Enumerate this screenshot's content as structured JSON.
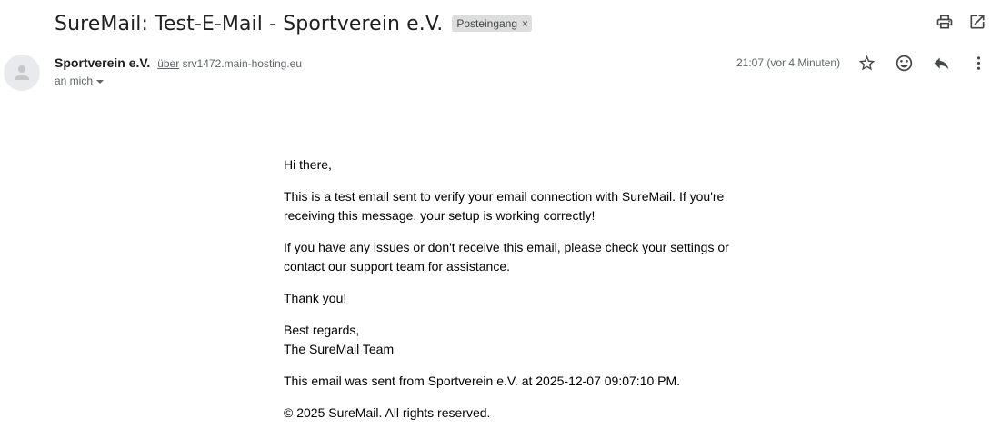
{
  "email": {
    "subject": "SureMail: Test-E-Mail - Sportverein e.V.",
    "label": "Posteingang",
    "label_remove": "×",
    "sender_name": "Sportverein e.V.",
    "via_word": "über",
    "via_domain": "srv1472.main-hosting.eu",
    "recipient": "an mich",
    "time": "21:07 (vor 4 Minuten)"
  },
  "body": {
    "greeting": "Hi there,",
    "paragraph1": "This is a test email sent to verify your email connection with SureMail. If you're receiving this message, your setup is working correctly!",
    "paragraph2": "If you have any issues or don't receive this email, please check your settings or contact our support team for assistance.",
    "thanks": "Thank you!",
    "regards": "Best regards,",
    "team": "The SureMail Team",
    "sent_info": "This email was sent from Sportverein e.V. at 2025-12-07 09:07:10 PM.",
    "copyright": "© 2025 SureMail. All rights reserved."
  },
  "icons": {
    "print": "print-icon",
    "open_new_window": "open-in-new-window-icon",
    "star": "star-icon",
    "emoji": "emoji-icon",
    "reply": "reply-icon",
    "more": "more-vert-icon"
  }
}
